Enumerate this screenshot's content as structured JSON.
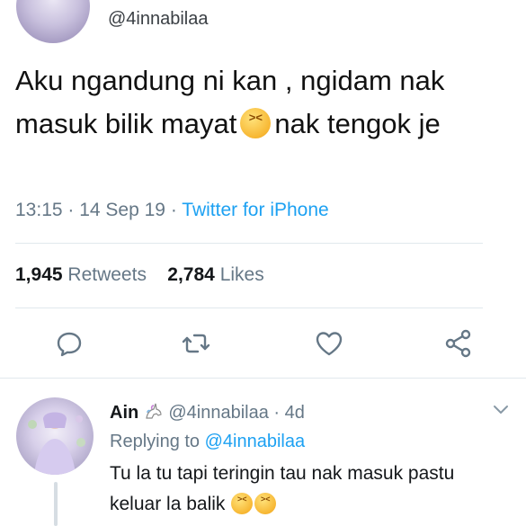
{
  "tweet": {
    "handle": "@4innabilaa",
    "text_part1": "Aku ngandung ni kan , ngidam nak masuk bilik mayat",
    "text_part2": "nak tengok je",
    "time": "13:15",
    "date": "14 Sep 19",
    "via": "Twitter for iPhone",
    "retweets_count": "1,945",
    "retweets_label": "Retweets",
    "likes_count": "2,784",
    "likes_label": "Likes",
    "emoji_name": "persevering-face-emoji"
  },
  "actions": {
    "icons": [
      "reply-icon",
      "retweet-icon",
      "like-icon",
      "share-icon"
    ],
    "color": "#657786"
  },
  "reply": {
    "name": "Ain",
    "handle": "@4innabilaa",
    "age": "4d",
    "replying_label": "Replying to",
    "replying_to": "@4innabilaa",
    "text": "Tu la tu tapi teringin tau nak masuk pastu keluar la balik"
  },
  "colors": {
    "link": "#1da1f2",
    "secondary": "#657786",
    "divider": "#e1e8ed"
  }
}
